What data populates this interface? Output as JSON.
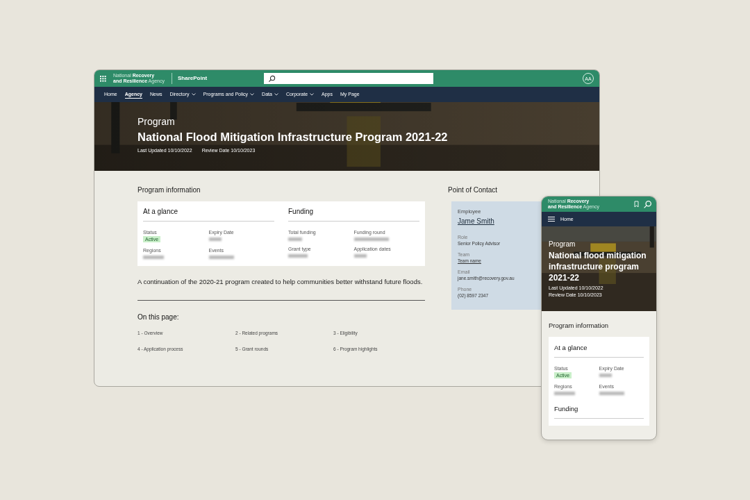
{
  "desktop": {
    "brand": [
      "National **Recovery**",
      "**and Resilience** Agency"
    ],
    "product": "SharePoint",
    "avatar": "AA",
    "nav": [
      {
        "label": "Home",
        "selected": false,
        "dropdown": false
      },
      {
        "label": "Agency",
        "selected": true,
        "dropdown": false
      },
      {
        "label": "News",
        "selected": false,
        "dropdown": false
      },
      {
        "label": "Directory",
        "selected": false,
        "dropdown": true
      },
      {
        "label": "Programs and Policy",
        "selected": false,
        "dropdown": true
      },
      {
        "label": "Data",
        "selected": false,
        "dropdown": true
      },
      {
        "label": "Corporate",
        "selected": false,
        "dropdown": true
      },
      {
        "label": "Apps",
        "selected": false,
        "dropdown": false
      },
      {
        "label": "My Page",
        "selected": false,
        "dropdown": false
      }
    ],
    "hero": {
      "kicker": "Program",
      "title": "National Flood Mitigation Infrastructure Program 2021-22",
      "last_updated": "Last Updated 10/10/2022",
      "review_date": "Review Date 10/10/2023"
    },
    "section_title": "Program information",
    "cards": [
      {
        "title": "At a glance",
        "fields": [
          {
            "label": "Status",
            "kind": "badge",
            "value": "Active"
          },
          {
            "label": "Expiry Date",
            "kind": "redacted"
          },
          {
            "label": "Regions",
            "kind": "redacted"
          },
          {
            "label": "Events",
            "kind": "redacted"
          }
        ]
      },
      {
        "title": "Funding",
        "fields": [
          {
            "label": "Total funding",
            "kind": "redacted"
          },
          {
            "label": "Funding round",
            "kind": "redacted"
          },
          {
            "label": "Grant type",
            "kind": "redacted"
          },
          {
            "label": "Application dates",
            "kind": "redacted"
          }
        ]
      }
    ],
    "description": "A continuation of the 2020-21 program created to help communities better withstand future floods.",
    "on_this_page": {
      "heading": "On this page:",
      "links": [
        "1 - Overview",
        "2 - Related programs",
        "3 - Eligibility",
        "4 - Application process",
        "5 - Grant rounds",
        "6 - Program highlights"
      ]
    },
    "contact": {
      "heading": "Point of Contact",
      "employee_label": "Employee",
      "name": "Jame Smith",
      "fields": [
        {
          "label": "Role",
          "value": "Senior Policy Advisor",
          "kind": "text"
        },
        {
          "label": "Team",
          "value": "Team name",
          "kind": "link"
        },
        {
          "label": "Email",
          "value": "jane.smith@recovery.gov.au",
          "kind": "text"
        },
        {
          "label": "Phone",
          "value": "(02) 8597 2347",
          "kind": "text"
        }
      ]
    }
  },
  "mobile": {
    "brand": [
      "National **Recovery**",
      "**and Resilience** Agency"
    ],
    "nav_label": "Home",
    "hero": {
      "kicker": "Program",
      "title": "National flood mitigation infrastructure program 2021-22",
      "last_updated": "Last Updated 10/10/2022",
      "review_date": "Review Date 10/10/2023"
    },
    "section_title": "Program information",
    "card": {
      "title": "At a glance",
      "fields": [
        {
          "label": "Status",
          "kind": "badge",
          "value": "Active"
        },
        {
          "label": "Expiry Date",
          "kind": "redacted"
        },
        {
          "label": "Regions",
          "kind": "redacted"
        },
        {
          "label": "Events",
          "kind": "redacted"
        }
      ]
    },
    "next_card_title": "Funding"
  }
}
